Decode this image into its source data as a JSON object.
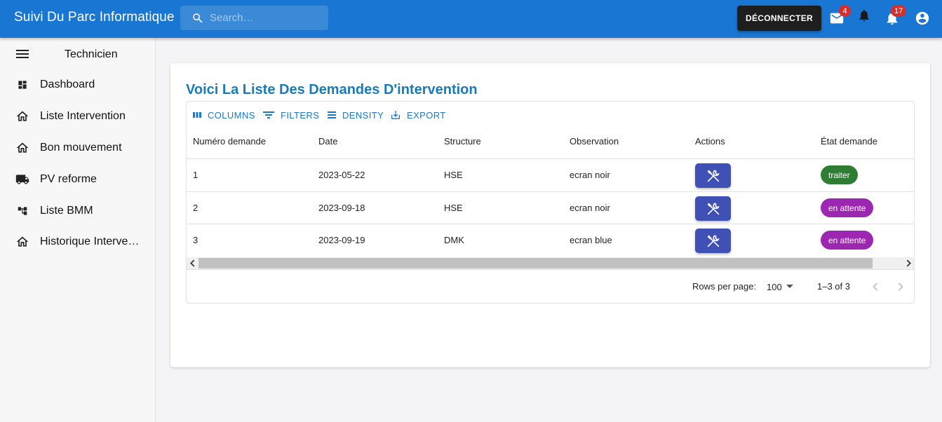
{
  "appbar": {
    "title": "Suivi Du Parc Informatique",
    "search_placeholder": "Search…",
    "logout_label": "DÉCONNECTER",
    "mail_badge": "4",
    "notifications_badge": "17"
  },
  "sidebar": {
    "role": "Technicien",
    "items": [
      {
        "label": "Dashboard",
        "icon": "dashboard-icon"
      },
      {
        "label": "Liste Intervention",
        "icon": "home-icon"
      },
      {
        "label": "Bon mouvement",
        "icon": "home-icon"
      },
      {
        "label": "PV reforme",
        "icon": "truck-icon"
      },
      {
        "label": "Liste BMM",
        "icon": "account-tree-icon"
      },
      {
        "label": "Historique Intervention",
        "icon": "home-icon"
      }
    ]
  },
  "main": {
    "title": "Voici La Liste Des Demandes D'intervention",
    "toolbar": {
      "columns": "COLUMNS",
      "filters": "FILTERS",
      "density": "DENSITY",
      "export": "EXPORT"
    },
    "columns": [
      "Numéro demande",
      "Date",
      "Structure",
      "Observation",
      "Actions",
      "État demande"
    ],
    "rows": [
      {
        "numero": "1",
        "date": "2023-05-22",
        "structure": "HSE",
        "observation": "ecran noir",
        "etat": "traiter",
        "etat_color": "#2e7d32"
      },
      {
        "numero": "2",
        "date": "2023-09-18",
        "structure": "HSE",
        "observation": "ecran noir",
        "etat": "en attente",
        "etat_color": "#9c27b0"
      },
      {
        "numero": "3",
        "date": "2023-09-19",
        "structure": "DMK",
        "observation": "ecran blue",
        "etat": "en attente",
        "etat_color": "#9c27b0"
      }
    ],
    "footer": {
      "rows_per_page_label": "Rows per page:",
      "rows_per_page_value": "100",
      "range": "1–3 of 3"
    }
  },
  "colors": {
    "appbar": "#1976d2",
    "accent": "#1976d2",
    "action_button": "#3f51b5",
    "title": "#1a7bb9"
  }
}
